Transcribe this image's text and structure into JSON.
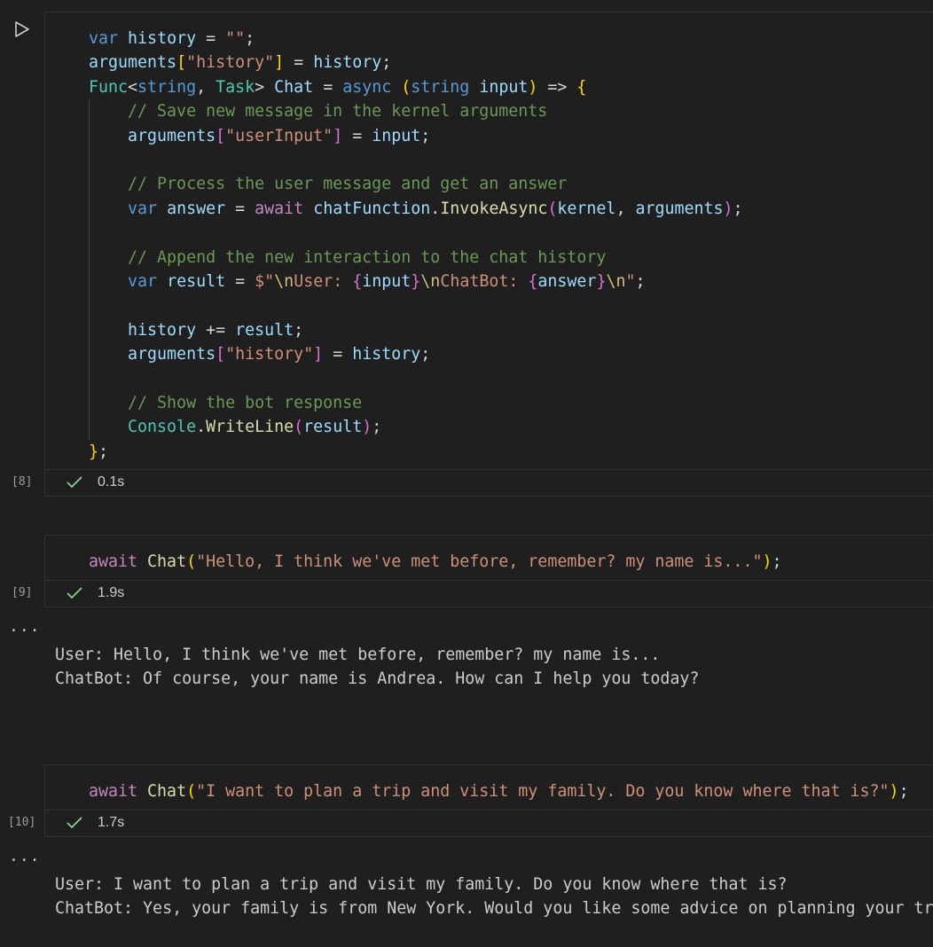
{
  "cells": [
    {
      "exec_count": "[8]",
      "duration": "0.1s",
      "code": [
        [
          [
            "kw",
            "var"
          ],
          [
            "op",
            " "
          ],
          [
            "id",
            "history"
          ],
          [
            "op",
            " = "
          ],
          [
            "str",
            "\"\""
          ],
          [
            "op",
            ";"
          ]
        ],
        [
          [
            "id",
            "arguments"
          ],
          [
            "p1",
            "["
          ],
          [
            "str",
            "\"history\""
          ],
          [
            "p1",
            "]"
          ],
          [
            "op",
            " = "
          ],
          [
            "id",
            "history"
          ],
          [
            "op",
            ";"
          ]
        ],
        [
          [
            "ty",
            "Func"
          ],
          [
            "op",
            "<"
          ],
          [
            "kw",
            "string"
          ],
          [
            "op",
            ", "
          ],
          [
            "ty",
            "Task"
          ],
          [
            "op",
            "> "
          ],
          [
            "id",
            "Chat"
          ],
          [
            "op",
            " = "
          ],
          [
            "kw",
            "async"
          ],
          [
            "op",
            " "
          ],
          [
            "p1",
            "("
          ],
          [
            "kw",
            "string"
          ],
          [
            "op",
            " "
          ],
          [
            "id",
            "input"
          ],
          [
            "p1",
            ")"
          ],
          [
            "op",
            " => "
          ],
          [
            "p1",
            "{"
          ]
        ],
        [
          [
            "op",
            "    "
          ],
          [
            "com",
            "// Save new message in the kernel arguments"
          ]
        ],
        [
          [
            "op",
            "    "
          ],
          [
            "id",
            "arguments"
          ],
          [
            "p2",
            "["
          ],
          [
            "str",
            "\"userInput\""
          ],
          [
            "p2",
            "]"
          ],
          [
            "op",
            " = "
          ],
          [
            "id",
            "input"
          ],
          [
            "op",
            ";"
          ]
        ],
        [],
        [
          [
            "op",
            "    "
          ],
          [
            "com",
            "// Process the user message and get an answer"
          ]
        ],
        [
          [
            "op",
            "    "
          ],
          [
            "kw",
            "var"
          ],
          [
            "op",
            " "
          ],
          [
            "id",
            "answer"
          ],
          [
            "op",
            " = "
          ],
          [
            "kw2",
            "await"
          ],
          [
            "op",
            " "
          ],
          [
            "id",
            "chatFunction"
          ],
          [
            "op",
            "."
          ],
          [
            "fn",
            "InvokeAsync"
          ],
          [
            "p2",
            "("
          ],
          [
            "id",
            "kernel"
          ],
          [
            "op",
            ", "
          ],
          [
            "id",
            "arguments"
          ],
          [
            "p2",
            ")"
          ],
          [
            "op",
            ";"
          ]
        ],
        [],
        [
          [
            "op",
            "    "
          ],
          [
            "com",
            "// Append the new interaction to the chat history"
          ]
        ],
        [
          [
            "op",
            "    "
          ],
          [
            "kw",
            "var"
          ],
          [
            "op",
            " "
          ],
          [
            "id",
            "result"
          ],
          [
            "op",
            " = "
          ],
          [
            "str",
            "$\""
          ],
          [
            "esc",
            "\\n"
          ],
          [
            "str",
            "User: "
          ],
          [
            "p2",
            "{"
          ],
          [
            "id",
            "input"
          ],
          [
            "p2",
            "}"
          ],
          [
            "esc",
            "\\n"
          ],
          [
            "str",
            "ChatBot: "
          ],
          [
            "p2",
            "{"
          ],
          [
            "id",
            "answer"
          ],
          [
            "p2",
            "}"
          ],
          [
            "esc",
            "\\n"
          ],
          [
            "str",
            "\""
          ],
          [
            "op",
            ";"
          ]
        ],
        [],
        [
          [
            "op",
            "    "
          ],
          [
            "id",
            "history"
          ],
          [
            "op",
            " += "
          ],
          [
            "id",
            "result"
          ],
          [
            "op",
            ";"
          ]
        ],
        [
          [
            "op",
            "    "
          ],
          [
            "id",
            "arguments"
          ],
          [
            "p2",
            "["
          ],
          [
            "str",
            "\"history\""
          ],
          [
            "p2",
            "]"
          ],
          [
            "op",
            " = "
          ],
          [
            "id",
            "history"
          ],
          [
            "op",
            ";"
          ]
        ],
        [],
        [
          [
            "op",
            "    "
          ],
          [
            "com",
            "// Show the bot response"
          ]
        ],
        [
          [
            "op",
            "    "
          ],
          [
            "ty",
            "Console"
          ],
          [
            "op",
            "."
          ],
          [
            "fn",
            "WriteLine"
          ],
          [
            "p2",
            "("
          ],
          [
            "id",
            "result"
          ],
          [
            "p2",
            ")"
          ],
          [
            "op",
            ";"
          ]
        ],
        [
          [
            "p1",
            "}"
          ],
          [
            "op",
            ";"
          ]
        ]
      ],
      "output": []
    },
    {
      "exec_count": "[9]",
      "duration": "1.9s",
      "code": [
        [
          [
            "kw2",
            "await"
          ],
          [
            "op",
            " "
          ],
          [
            "fn",
            "Chat"
          ],
          [
            "p1",
            "("
          ],
          [
            "str",
            "\"Hello, I think we've met before, remember? my name is...\""
          ],
          [
            "p1",
            ")"
          ],
          [
            "op",
            ";"
          ]
        ]
      ],
      "output": [
        "User: Hello, I think we've met before, remember? my name is...",
        "ChatBot: Of course, your name is Andrea. How can I help you today?"
      ]
    },
    {
      "exec_count": "[10]",
      "duration": "1.7s",
      "code": [
        [
          [
            "kw2",
            "await"
          ],
          [
            "op",
            " "
          ],
          [
            "fn",
            "Chat"
          ],
          [
            "p1",
            "("
          ],
          [
            "str",
            "\"I want to plan a trip and visit my family. Do you know where that is?\""
          ],
          [
            "p1",
            ")"
          ],
          [
            "op",
            ";"
          ]
        ]
      ],
      "output": [
        "User: I want to plan a trip and visit my family. Do you know where that is?",
        "ChatBot: Yes, your family is from New York. Would you like some advice on planning your tr"
      ]
    }
  ],
  "ui": {
    "output_more_label": "...",
    "run_icon": "play-icon",
    "check_icon": "check-icon",
    "colors": {
      "background": "#1f1f1f",
      "border": "#313131",
      "success": "#89d185"
    }
  }
}
